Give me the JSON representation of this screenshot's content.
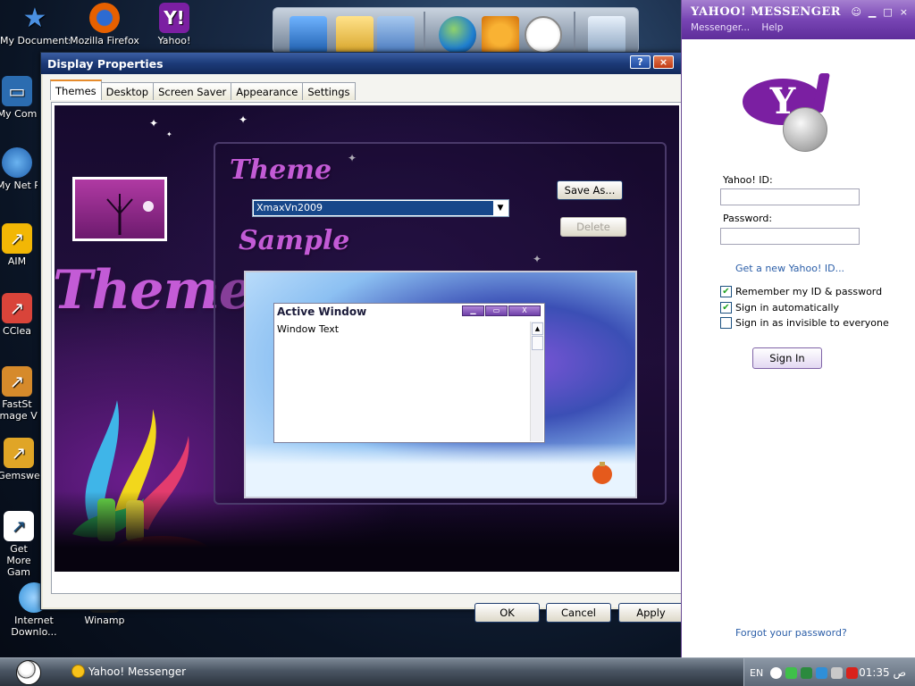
{
  "desktop": {
    "icons": [
      {
        "label": "My Documents",
        "color": "#3a7bd5"
      },
      {
        "label": "Mozilla Firefox",
        "color": "#e66000"
      },
      {
        "label": "Yahoo!",
        "color": "#7b1fa2"
      },
      {
        "label": "My Com",
        "color": "#2b6cb0"
      },
      {
        "label": "My Net Plac",
        "color": "#2b6cb0"
      },
      {
        "label": "AIM",
        "color": "#f2b705"
      },
      {
        "label": "CClea",
        "color": "#d9443a"
      },
      {
        "label": "FastSt Image V",
        "color": "#d68a2b"
      },
      {
        "label": "Gemswe",
        "color": "#e0a526"
      },
      {
        "label": "Get More Gam",
        "color": "#ffffff"
      },
      {
        "label": "Internet Downlo...",
        "color": "#2f8fd8"
      },
      {
        "label": "Winamp",
        "color": "#1c1c1c"
      }
    ]
  },
  "display_properties": {
    "title": "Display Properties",
    "help_button": "?",
    "close_button": "×",
    "tabs": [
      "Themes",
      "Desktop",
      "Screen Saver",
      "Appearance",
      "Settings"
    ],
    "active_tab": "Themes",
    "theme_heading": "Theme",
    "sample_heading": "Sample",
    "big_title": "Themes",
    "theme_select_value": "XmaxVn2009",
    "save_as_label": "Save As...",
    "delete_label": "Delete",
    "sample_window": {
      "caption": "Active Window",
      "body_text": "Window Text"
    },
    "ok_label": "OK",
    "cancel_label": "Cancel",
    "apply_label": "Apply"
  },
  "yahoo_messenger": {
    "brand": "YAHOO! MESSENGER",
    "menu": [
      "Messenger...",
      "Help"
    ],
    "logo_text": "Y",
    "yahoo_id_label": "Yahoo! ID:",
    "yahoo_id_value": "",
    "password_label": "Password:",
    "password_value": "",
    "new_id_link": "Get a new Yahoo! ID...",
    "remember_label": "Remember my ID & password",
    "remember_checked": true,
    "auto_signin_label": "Sign in automatically",
    "auto_signin_checked": true,
    "invisible_label": "Sign in as invisible to everyone",
    "invisible_checked": false,
    "sign_in_label": "Sign In",
    "forgot_link": "Forgot your password?"
  },
  "taskbar": {
    "task_label": "Yahoo! Messenger",
    "language": "EN",
    "clock": "01:35 ص"
  }
}
